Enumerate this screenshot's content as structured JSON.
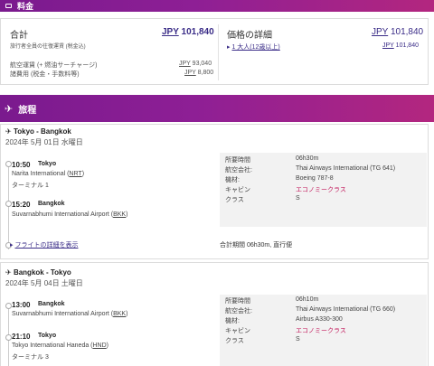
{
  "fare": {
    "band_label": "料金",
    "total_label": "合計",
    "total_currency": "JPY",
    "total_amount": "101,840",
    "total_note": "旅行者全員の往復運賃 (税金込)",
    "lines": [
      {
        "label": "航空運賃 (+ 燃油サーチャージ)",
        "currency": "JPY",
        "amount": "93,040"
      },
      {
        "label": "諸費用 (税金・手数料等)",
        "currency": "JPY",
        "amount": "8,800"
      }
    ],
    "detail_label": "価格の詳細",
    "detail_currency": "JPY",
    "detail_amount": "101,840",
    "pax_label": "1 大人(12歳以上)",
    "pax_currency": "JPY",
    "pax_amount": "101,840"
  },
  "itinerary": {
    "band_label": "旅程",
    "flights": [
      {
        "route": "Tokyo - Bangkok",
        "date": "2024年 5月 01日 水曜日",
        "dep_time": "10:50",
        "dep_city": "Tokyo",
        "dep_airport": "Narita International (",
        "dep_code": "NRT",
        "dep_close": ")",
        "dep_terminal": "ターミナル 1",
        "arr_time": "15:20",
        "arr_city": "Bangkok",
        "arr_airport": "Suvarnabhumi International Airport (",
        "arr_code": "BKK",
        "arr_close": ")",
        "arr_terminal": "",
        "details": {
          "duration_label": "所要時間",
          "duration": "06h30m",
          "carrier_label": "航空会社:",
          "carrier": "Thai Airways International (TG 641)",
          "aircraft_label": "機材:",
          "aircraft": "Boeing 787-8",
          "cabin_label": "キャビン",
          "cabin": "エコノミークラス",
          "class_label": "クラス",
          "class": "S"
        },
        "details_link": "フライトの詳細を表示",
        "total_duration_text": "合計期間 06h30m, 直行便"
      },
      {
        "route": "Bangkok - Tokyo",
        "date": "2024年 5月 04日 土曜日",
        "dep_time": "13:00",
        "dep_city": "Bangkok",
        "dep_airport": "Suvarnabhumi International Airport (",
        "dep_code": "BKK",
        "dep_close": ")",
        "dep_terminal": "",
        "arr_time": "21:10",
        "arr_city": "Tokyo",
        "arr_airport": "Tokyo International Haneda (",
        "arr_code": "HND",
        "arr_close": ")",
        "arr_terminal": "ターミナル 3",
        "details": {
          "duration_label": "所要時間",
          "duration": "06h10m",
          "carrier_label": "航空会社:",
          "carrier": "Thai Airways International (TG 660)",
          "aircraft_label": "機材:",
          "aircraft": "Airbus A330-300",
          "cabin_label": "キャビン",
          "cabin": "エコノミークラス",
          "class_label": "クラス",
          "class": "S"
        }
      }
    ]
  },
  "icons": {
    "fare": "wallet-icon",
    "itinerary": "airplane-icon"
  }
}
